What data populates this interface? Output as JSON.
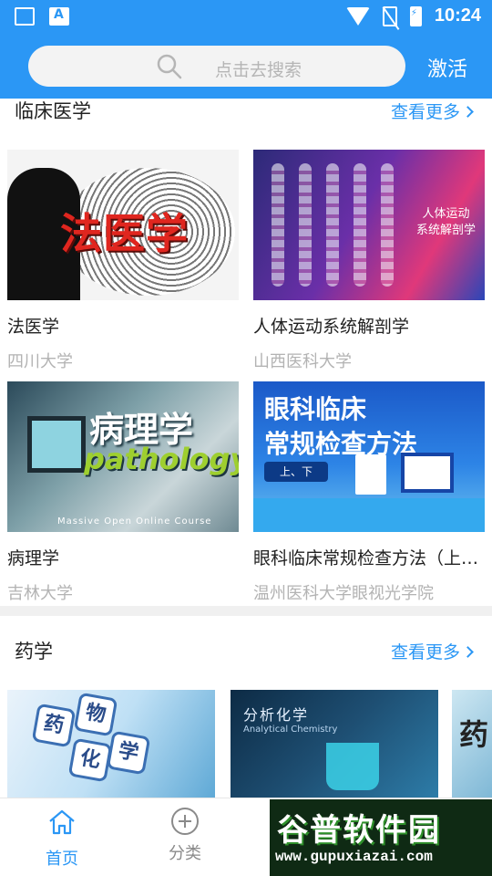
{
  "status_bar": {
    "time": "10:24"
  },
  "header": {
    "search_placeholder": "点击去搜索",
    "activate_label": "激活"
  },
  "sections": [
    {
      "title": "临床医学",
      "more_label": "查看更多",
      "courses": [
        {
          "title": "法医学",
          "school": "四川大学",
          "cover_text": "法医学"
        },
        {
          "title": "人体运动系统解剖学",
          "school": "山西医科大学",
          "cover_text": "人体运动\n系统解剖学"
        },
        {
          "title": "病理学",
          "school": "吉林大学",
          "cover_text_1": "病理学",
          "cover_text_2": "pathology",
          "cover_text_3": "Massive Open Online Course"
        },
        {
          "title": "眼科临床常规检查方法（上、下）",
          "school": "温州医科大学眼视光学院",
          "cover_text_1": "眼科临床",
          "cover_text_2": "常规检查方法",
          "cover_tag": "上、下"
        }
      ]
    },
    {
      "title": "药学",
      "more_label": "查看更多",
      "covers": [
        {
          "chars": [
            "药",
            "物",
            "化",
            "学"
          ]
        },
        {
          "line1": "分析化学",
          "line2": "Analytical Chemistry"
        },
        {
          "char": "药"
        }
      ]
    }
  ],
  "tabbar": {
    "tabs": [
      {
        "label": "首页",
        "active": true
      },
      {
        "label": "分类",
        "active": false
      }
    ]
  },
  "watermark": {
    "text": "谷普软件园",
    "url": "www.gupuxiazai.com"
  },
  "colors": {
    "primary": "#2b97f5",
    "text": "#222222",
    "muted": "#b3b3b3"
  }
}
